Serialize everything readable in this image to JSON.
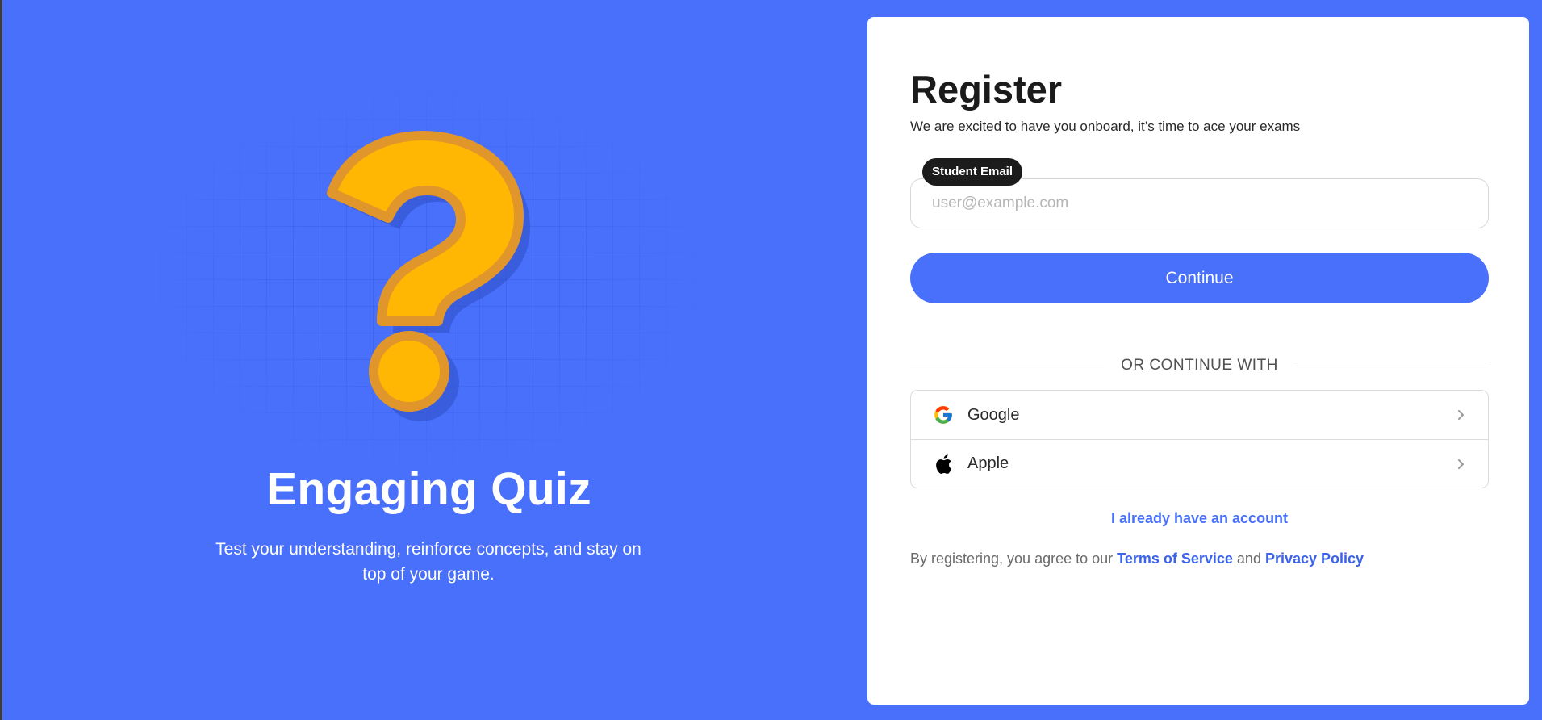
{
  "hero": {
    "title": "Engaging Quiz",
    "subtitle": "Test your understanding, reinforce concepts, and stay on top of your game.",
    "illustration": "question-mark-icon"
  },
  "register": {
    "title": "Register",
    "subtitle": "We are excited to have you onboard, it’s time to ace your exams",
    "email": {
      "label": "Student Email",
      "placeholder": "user@example.com",
      "value": ""
    },
    "continue_label": "Continue",
    "divider_label": "OR CONTINUE WITH",
    "providers": [
      {
        "label": "Google",
        "icon": "google-icon"
      },
      {
        "label": "Apple",
        "icon": "apple-icon"
      }
    ],
    "login_link": "I already have an account",
    "terms": {
      "prefix": "By registering, you agree to our",
      "tos": "Terms of Service",
      "joiner": "and",
      "privacy": "Privacy Policy"
    }
  },
  "colors": {
    "brand": "#4870fb",
    "question_mark": "#ffb703",
    "question_mark_outline": "#e0962a",
    "label_bg": "#1c1c1c"
  }
}
